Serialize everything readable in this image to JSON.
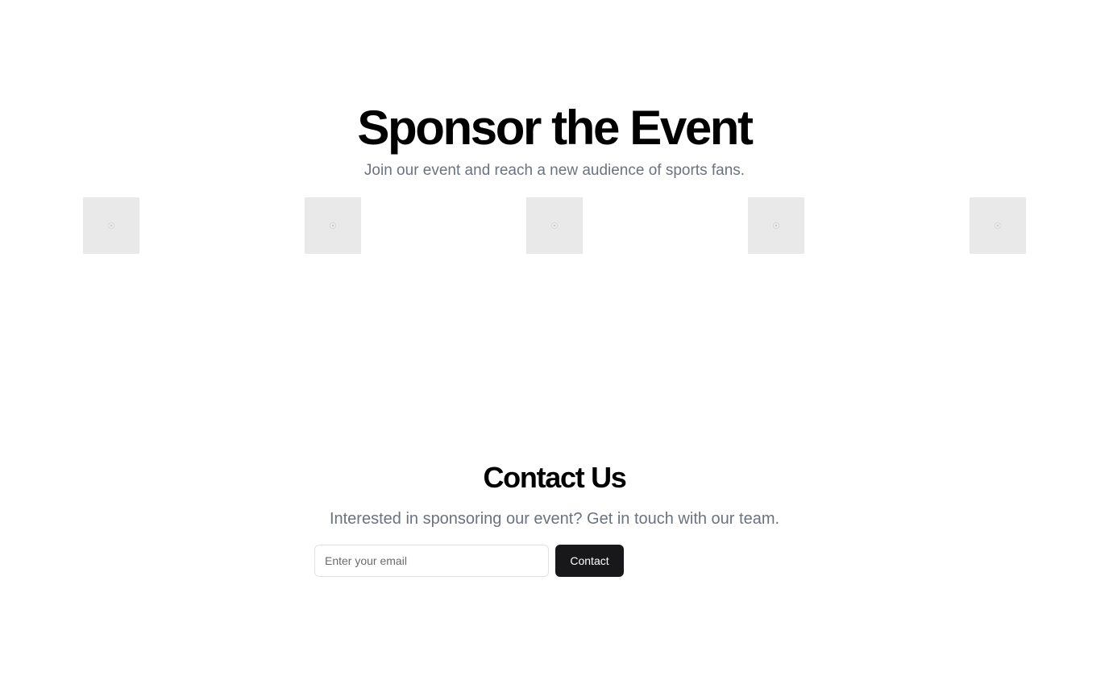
{
  "sponsor": {
    "title": "Sponsor the Event",
    "subtitle": "Join our event and reach a new audience of sports fans.",
    "logos": [
      {
        "icon": "placeholder-image-icon"
      },
      {
        "icon": "placeholder-image-icon"
      },
      {
        "icon": "placeholder-image-icon"
      },
      {
        "icon": "placeholder-image-icon"
      },
      {
        "icon": "placeholder-image-icon"
      }
    ]
  },
  "contact": {
    "title": "Contact Us",
    "subtitle": "Interested in sponsoring our event? Get in touch with our team.",
    "email_placeholder": "Enter your email",
    "email_value": "",
    "button_label": "Contact"
  },
  "colors": {
    "background": "#ffffff",
    "heading": "#000000",
    "muted_text": "#6b7280",
    "logo_placeholder": "#e9e9e9",
    "button_bg": "#18181b",
    "button_text": "#ffffff"
  }
}
